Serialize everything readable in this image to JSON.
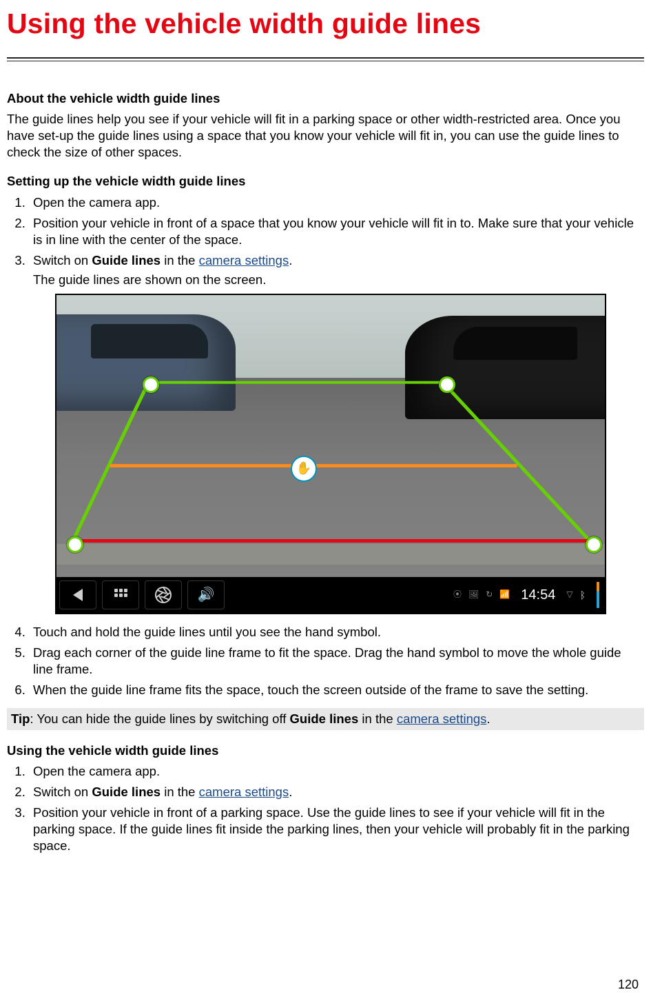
{
  "title": "Using the vehicle width guide lines",
  "section_about": {
    "heading": "About the vehicle width guide lines",
    "paragraph": "The guide lines help you see if your vehicle will fit in a parking space or other width-restricted area. Once you have set-up the guide lines using a space that you know your vehicle will fit in, you can use the guide lines to check the size of other spaces."
  },
  "section_setup": {
    "heading": "Setting up the vehicle width guide lines",
    "steps": {
      "s1": "Open the camera app.",
      "s2": "Position your vehicle in front of a space that you know your vehicle will fit in to. Make sure that your vehicle is in line with the center of the space.",
      "s3_pre": "Switch on ",
      "s3_bold": "Guide lines",
      "s3_mid": " in the ",
      "s3_link": "camera settings",
      "s3_post": ".",
      "s3_sub": "The guide lines are shown on the screen.",
      "s4": "Touch and hold the guide lines until you see the hand symbol.",
      "s5": "Drag each corner of the guide line frame to fit the space. Drag the hand symbol to move the whole guide line frame.",
      "s6": "When the guide line frame fits the space, touch the screen outside of the frame to save the setting."
    }
  },
  "tip": {
    "label": "Tip",
    "pre": ": You can hide the guide lines by switching off ",
    "bold": "Guide lines",
    "mid": " in the ",
    "link": "camera settings",
    "post": "."
  },
  "section_using": {
    "heading": "Using the vehicle width guide lines",
    "steps": {
      "s1": "Open the camera app.",
      "s2_pre": "Switch on ",
      "s2_bold": "Guide lines",
      "s2_mid": " in the ",
      "s2_link": "camera settings",
      "s2_post": ".",
      "s3": "Position your vehicle in front of a parking space. Use the guide lines to see if your vehicle will fit in the parking space. If the guide lines fit inside the parking lines, then your vehicle will probably fit in the parking space."
    }
  },
  "screenshot": {
    "hand_symbol": "✋",
    "statusbar_time": "14:54"
  },
  "page_number": "120"
}
